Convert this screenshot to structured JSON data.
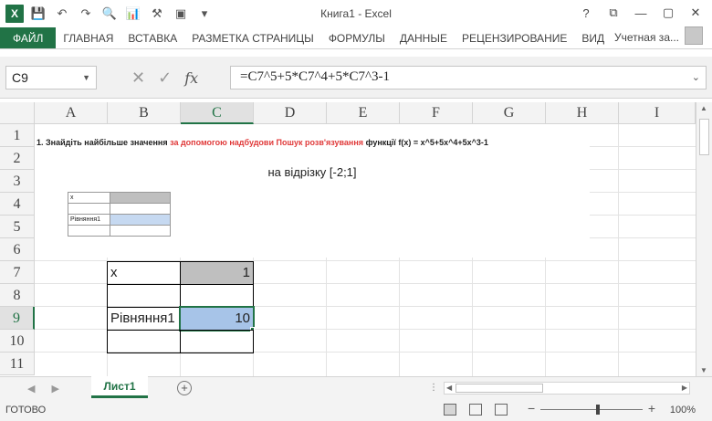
{
  "window": {
    "title": "Книга1 - Excel",
    "app_icon": "X",
    "account_label": "Учетная за...",
    "controls": [
      "?",
      "⧉",
      "—",
      "▢",
      "✕"
    ]
  },
  "ribbon": {
    "tabs": [
      "ФАЙЛ",
      "ГЛАВНАЯ",
      "ВСТАВКА",
      "РАЗМЕТКА СТРАНИЦЫ",
      "ФОРМУЛЫ",
      "ДАННЫЕ",
      "РЕЦЕНЗИРОВАНИЕ",
      "ВИД"
    ]
  },
  "formula_bar": {
    "name_box": "C9",
    "fx_label": "fx",
    "formula": "=C7^5+5*C7^4+5*C7^3-1"
  },
  "grid": {
    "columns": [
      "A",
      "B",
      "C",
      "D",
      "E",
      "F",
      "G",
      "H",
      "I"
    ],
    "rows": [
      "1",
      "2",
      "3",
      "4",
      "5",
      "6",
      "7",
      "8",
      "9",
      "10",
      "11"
    ],
    "selected_column": "C",
    "selected_row": "9"
  },
  "picture": {
    "task_prefix": "1. Знайдіть найбільше значення ",
    "task_red": "за допомогою надбудови Пошук розв'язування",
    "task_suffix": "  функції f(x) = x^5+5x^4+5x^3-1",
    "interval": "на відрізку [-2;1]",
    "mini_x_label": "x",
    "mini_eq_label": "Рівняння1"
  },
  "cells": {
    "B7": "x",
    "C7": "1",
    "B9": "Рівняння1",
    "C9": "10"
  },
  "sheets": {
    "active": "Лист1"
  },
  "status": {
    "text": "ГОТОВО",
    "zoom": "100%"
  }
}
